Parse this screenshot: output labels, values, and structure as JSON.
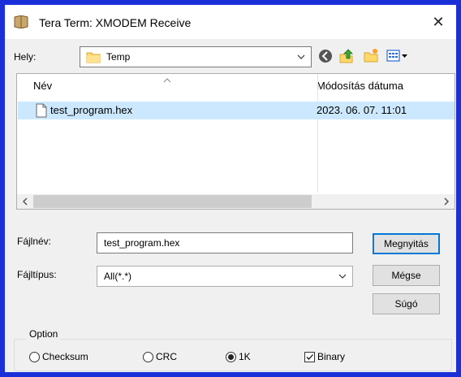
{
  "window": {
    "title": "Tera Term: XMODEM Receive",
    "close_glyph": "✕"
  },
  "location": {
    "label": "Hely:",
    "value": "Temp"
  },
  "file_list": {
    "columns": [
      "Név",
      "Módosítás dátuma"
    ],
    "rows": [
      {
        "name": "test_program.hex",
        "modified": "2023. 06. 07. 11:01"
      }
    ]
  },
  "filename": {
    "label": "Fájlnév:",
    "value": "test_program.hex"
  },
  "filetype": {
    "label": "Fájltípus:",
    "value": "All(*.*)"
  },
  "buttons": {
    "open": "Megnyitás",
    "cancel": "Mégse",
    "help": "Súgó"
  },
  "option": {
    "title": "Option",
    "checksum": {
      "label": "Checksum",
      "selected": false
    },
    "crc": {
      "label": "CRC",
      "selected": false
    },
    "k1": {
      "label": "1K",
      "selected": true
    },
    "binary": {
      "label": "Binary",
      "checked": true
    }
  },
  "icons": {
    "app": "tera-term-icon",
    "folder": "folder-icon",
    "back": "back-icon",
    "up": "up-folder-icon",
    "new_folder": "new-folder-icon",
    "view": "view-menu-icon",
    "file": "file-icon",
    "accent": "#0078d7",
    "selection": "#cce8ff",
    "frame": "#1b2fd8"
  }
}
